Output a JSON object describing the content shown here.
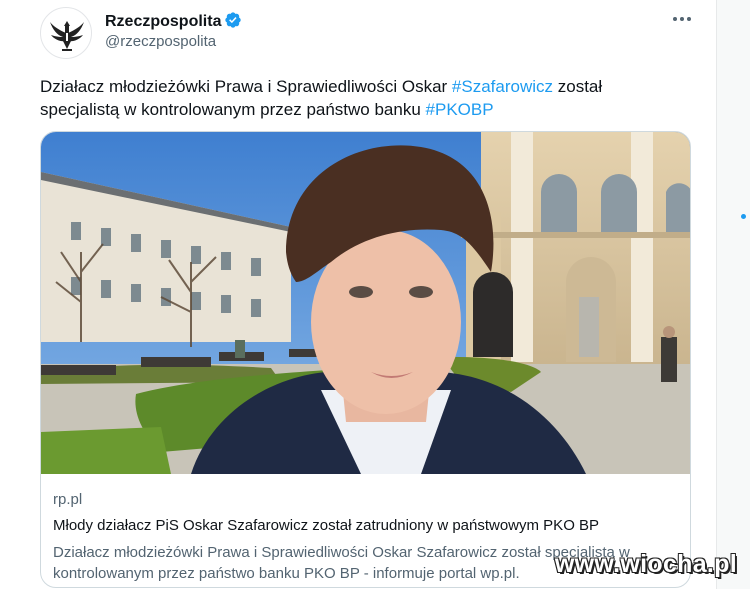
{
  "tweet": {
    "author": {
      "display_name": "Rzeczpospolita",
      "handle": "@rzeczpospolita",
      "verified": true,
      "avatar_icon": "eagle-logo"
    },
    "text": {
      "part1": "Działacz młodzieżówki Prawa i Sprawiedliwości Oskar ",
      "hashtag1": "#Szafarowicz",
      "part2": " został specjalistą w kontrolowanym przez państwo banku  ",
      "hashtag2": "#PKOBP"
    },
    "link_card": {
      "domain": "rp.pl",
      "title": "Młody działacz PiS Oskar Szafarowicz został zatrudniony w państwowym PKO BP",
      "description": "Działacz młodzieżówki Prawa i Sprawiedliwości Oskar Szafarowicz został specjalistą w kontrolowanym przez państwo banku PKO BP - informuje portal wp.pl."
    }
  },
  "watermark": "www.wiocha.pl",
  "colors": {
    "accent": "#1d9bf0",
    "text": "#0f1419",
    "muted": "#536471"
  }
}
